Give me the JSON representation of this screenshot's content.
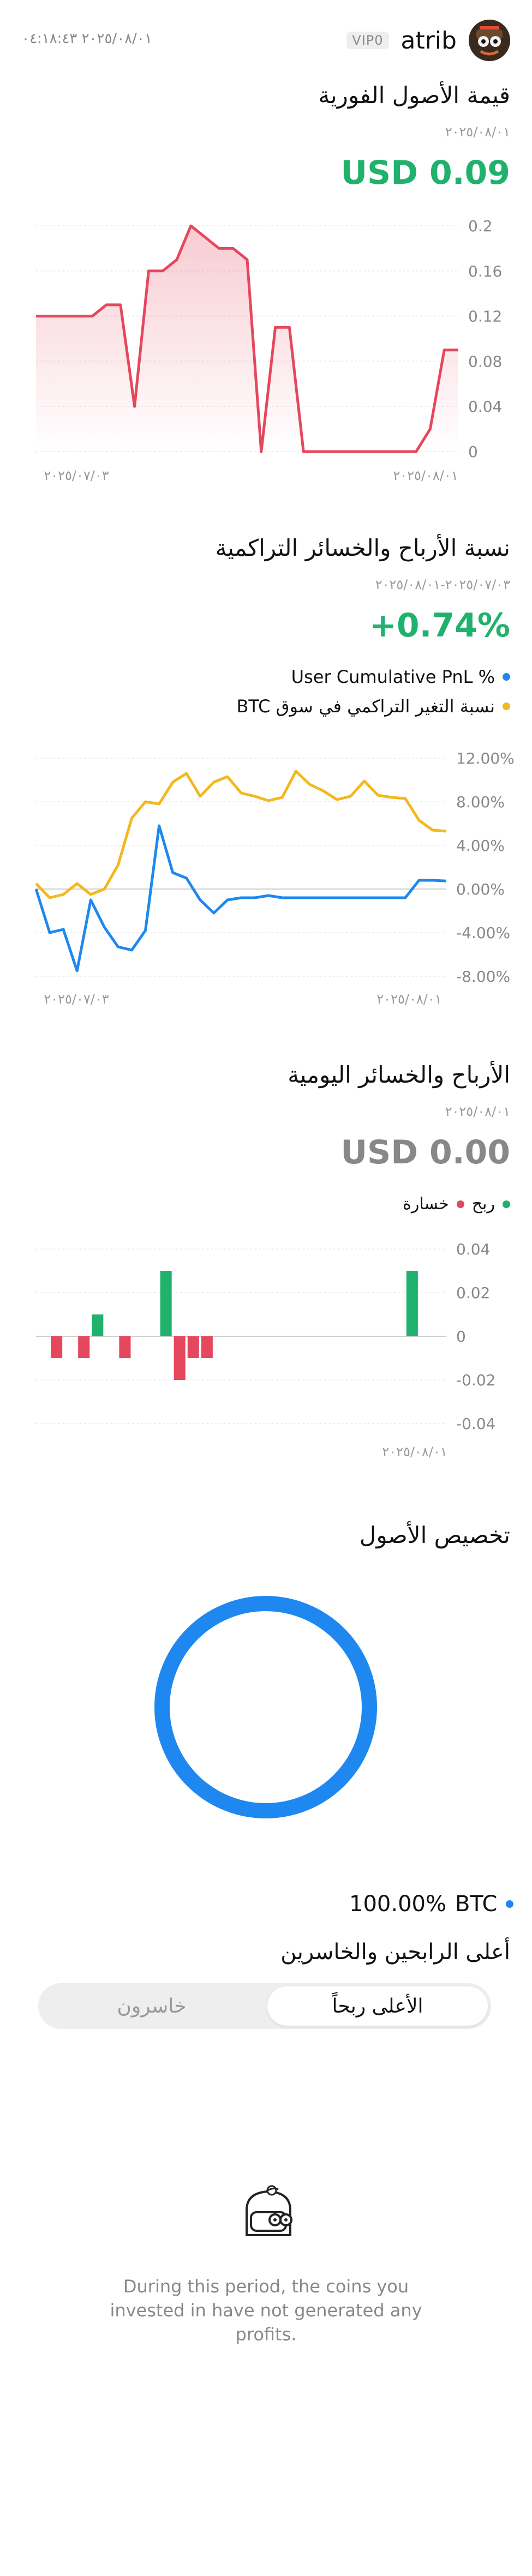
{
  "header": {
    "username": "atrib",
    "vip_badge": "VIP0",
    "datetime": "٢٠٢٥/٠٨/٠١ ٠٤:١٨:٤٣"
  },
  "spot_value": {
    "title": "قيمة الأصول الفورية",
    "date": "٢٠٢٥/٠٨/٠١",
    "value": "USD 0.09",
    "chart_data": {
      "type": "area",
      "color": "#e5475d",
      "x_labels": [
        "٢٠٢٥/٠٧/٠٣",
        "٢٠٢٥/٠٨/٠١"
      ],
      "y_ticks": [
        "0.2",
        "0.16",
        "0.12",
        "0.08",
        "0.04",
        "0"
      ],
      "ylim": [
        0,
        0.2
      ],
      "values": [
        0.12,
        0.12,
        0.12,
        0.12,
        0.12,
        0.13,
        0.13,
        0.04,
        0.16,
        0.16,
        0.17,
        0.2,
        0.19,
        0.18,
        0.18,
        0.17,
        0,
        0.11,
        0.11,
        0,
        0,
        0,
        0,
        0,
        0,
        0,
        0,
        0,
        0.02,
        0.09,
        0.09
      ]
    }
  },
  "cumulative_pnl": {
    "title": "نسبة الأرباح والخسائر التراكمية",
    "date_range": "٢٠٢٥/٠٧/٠٣-٢٠٢٥/٠٨/٠١",
    "value": "+0.74%",
    "legend": [
      {
        "label": "User Cumulative PnL %",
        "color": "#1e88f0"
      },
      {
        "label": "نسبة التغير التراكمي في سوق BTC",
        "color": "#f2b81e"
      }
    ],
    "chart_data": {
      "type": "line",
      "x_labels": [
        "٢٠٢٥/٠٧/٠٣",
        "٢٠٢٥/٠٨/٠١"
      ],
      "y_ticks": [
        "12.00%",
        "8.00%",
        "4.00%",
        "0.00%",
        "-4.00%",
        "-8.00%"
      ],
      "ylim": [
        -8,
        12
      ],
      "series": [
        {
          "name": "User Cumulative PnL %",
          "color": "#1e88f0",
          "values": [
            0,
            -4,
            -3.7,
            -7.5,
            -1,
            -3.5,
            -5.3,
            -5.6,
            -3.8,
            5.8,
            1.5,
            1,
            -1,
            -2.2,
            -1,
            -0.8,
            -0.8,
            -0.6,
            -0.8,
            -0.8,
            -0.8,
            -0.8,
            -0.8,
            -0.8,
            -0.8,
            -0.8,
            -0.8,
            -0.8,
            0.8,
            0.8,
            0.74
          ]
        },
        {
          "name": "نسبة التغير التراكمي في سوق BTC",
          "color": "#f2b81e",
          "values": [
            0.5,
            -0.8,
            -0.5,
            0.5,
            -0.5,
            0,
            2.2,
            6.5,
            8,
            7.8,
            9.8,
            10.6,
            8.5,
            9.8,
            10.3,
            8.8,
            8.5,
            8.1,
            8.4,
            10.8,
            9.6,
            9,
            8.2,
            8.5,
            9.9,
            8.6,
            8.4,
            8.3,
            6.3,
            5.4,
            5.3
          ]
        }
      ]
    }
  },
  "daily_pnl": {
    "title": "الأرباح والخسائر اليومية",
    "date": "٢٠٢٥/٠٨/٠١",
    "value": "USD 0.00",
    "legend": [
      {
        "label": "ربح",
        "color": "#20b26c"
      },
      {
        "label": "خسارة",
        "color": "#e5475d"
      }
    ],
    "chart_data": {
      "type": "bar",
      "x_labels": [
        "٢٠٢٥/٠٨/٠١"
      ],
      "y_ticks": [
        "0.04",
        "0.02",
        "0",
        "-0.02",
        "-0.04"
      ],
      "ylim": [
        -0.04,
        0.04
      ],
      "values": [
        0,
        -0.01,
        0,
        -0.01,
        0.01,
        0,
        -0.01,
        0,
        0,
        0.03,
        -0.02,
        -0.01,
        -0.01,
        0,
        0,
        0,
        0,
        0,
        0,
        0,
        0,
        0,
        0,
        0,
        0,
        0,
        0,
        0.03,
        0,
        0
      ]
    }
  },
  "allocation": {
    "title": "تخصيص الأصول",
    "items": [
      {
        "label": "BTC",
        "percent": "100.00%",
        "color": "#1e88f0",
        "share": 1
      }
    ]
  },
  "top_movers": {
    "title": "أعلى الرابحين والخاسرين",
    "tabs": [
      "الأعلى ربحاً",
      "خاسرون"
    ],
    "empty_message": "During this period, the coins you invested in have not generated any profits."
  }
}
